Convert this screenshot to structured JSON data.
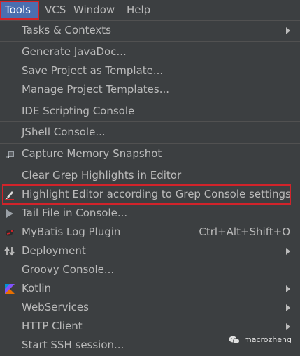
{
  "menubar": {
    "items": [
      {
        "label": "Tools"
      },
      {
        "label": "VCS"
      },
      {
        "label": "Window"
      },
      {
        "label": "Help"
      }
    ]
  },
  "menu": {
    "items": [
      {
        "label": "Tasks & Contexts",
        "submenu": true
      },
      {
        "label": "Generate JavaDoc..."
      },
      {
        "label": "Save Project as Template..."
      },
      {
        "label": "Manage Project Templates..."
      },
      {
        "label": "IDE Scripting Console"
      },
      {
        "label": "JShell Console..."
      },
      {
        "label": "Capture Memory Snapshot",
        "icon": "memory-snapshot-icon"
      },
      {
        "label": "Clear Grep Highlights in Editor"
      },
      {
        "label": "Highlight Editor according to Grep Console settings",
        "icon": "highlighter-pen-icon"
      },
      {
        "label": "Tail File in Console...",
        "icon": "play-icon"
      },
      {
        "label": "MyBatis Log Plugin",
        "icon": "mybatis-bird-icon",
        "shortcut": "Ctrl+Alt+Shift+O"
      },
      {
        "label": "Deployment",
        "icon": "deployment-arrows-icon",
        "submenu": true
      },
      {
        "label": "Groovy Console..."
      },
      {
        "label": "Kotlin",
        "icon": "kotlin-icon",
        "submenu": true
      },
      {
        "label": "WebServices",
        "submenu": true
      },
      {
        "label": "HTTP Client",
        "submenu": true
      },
      {
        "label": "Start SSH session..."
      }
    ]
  },
  "watermark": {
    "text": "macrozheng",
    "icon": "wechat-icon"
  },
  "colors": {
    "background": "#3c3f41",
    "text": "#bbbbbb",
    "highlight": "#d2232a",
    "active": "#4b6eaf"
  }
}
